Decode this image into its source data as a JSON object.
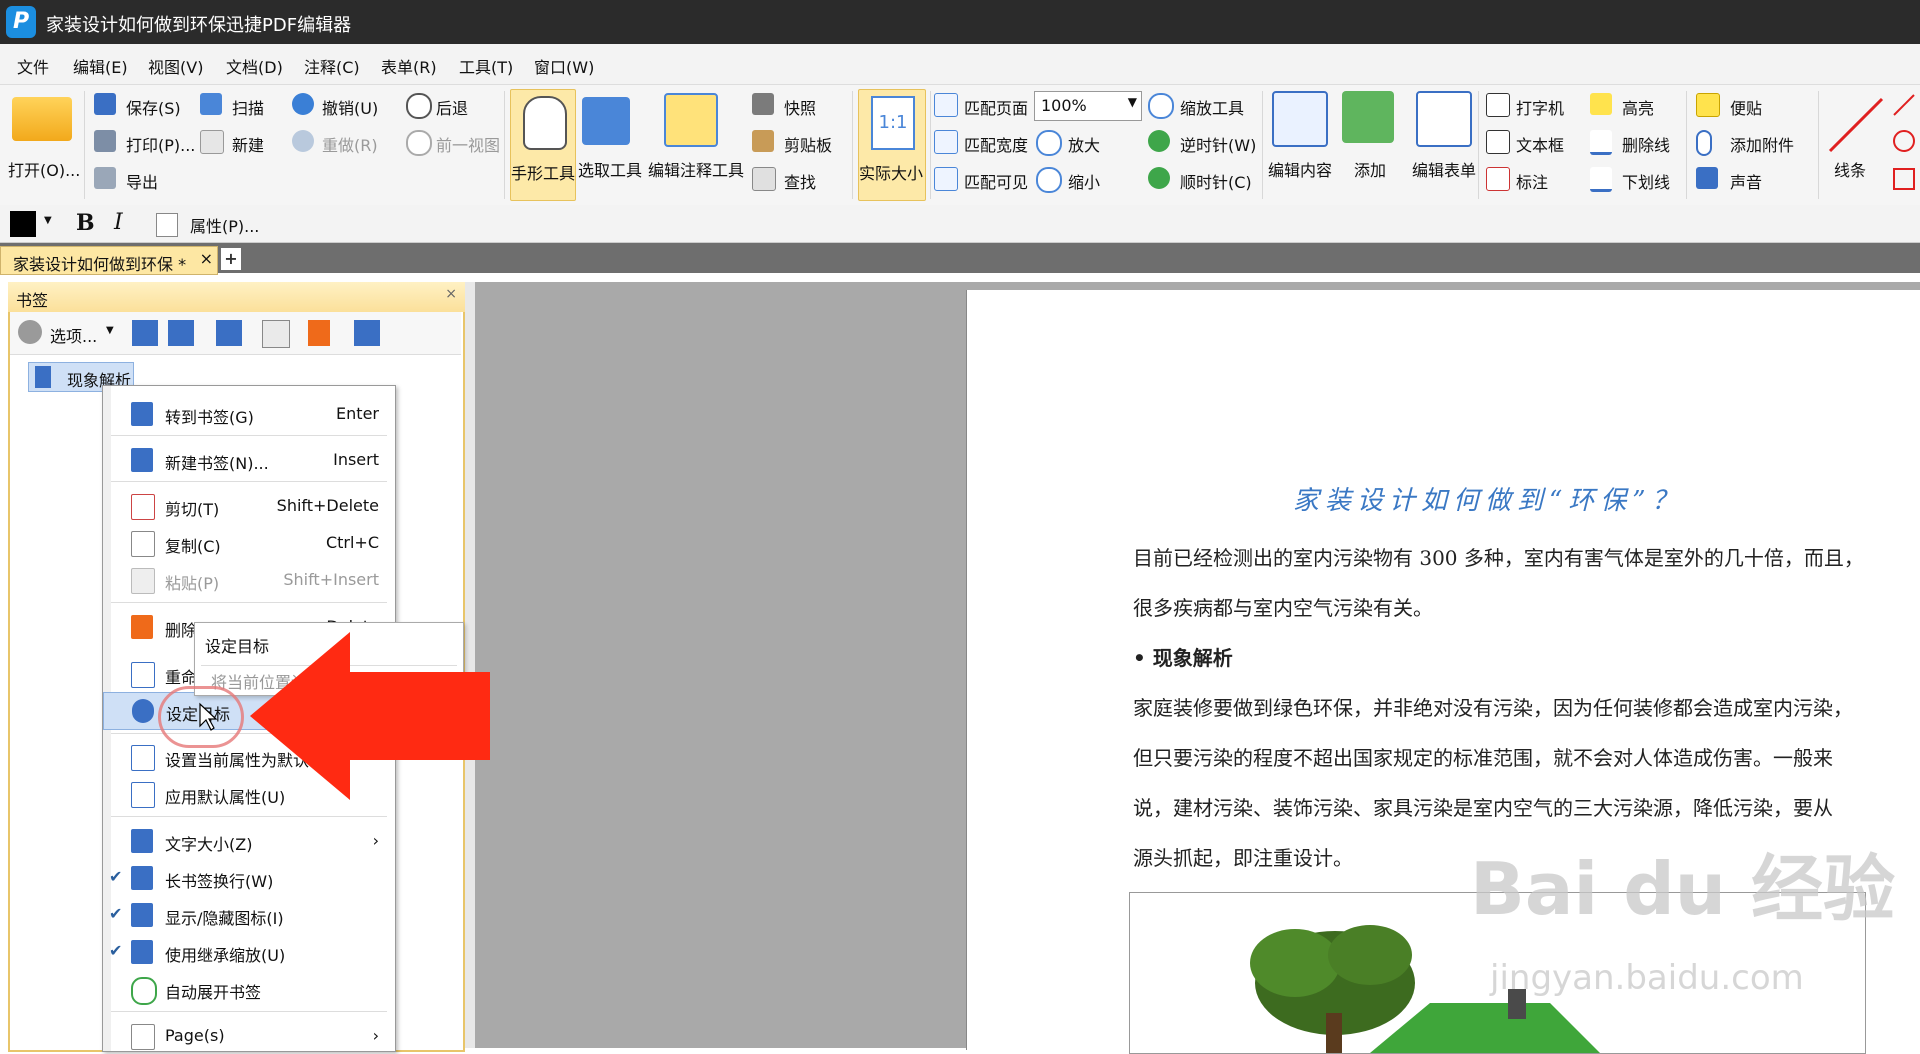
{
  "window": {
    "title": "家装设计如何做到环保迅捷PDF编辑器",
    "logo": "P"
  },
  "menubar": [
    "文件",
    "编辑(E)",
    "视图(V)",
    "文档(D)",
    "注释(C)",
    "表单(R)",
    "工具(T)",
    "窗口(W)"
  ],
  "ribbon": {
    "open": "打开(O)...",
    "save": "保存(S)",
    "print": "打印(P)...",
    "export": "导出",
    "scan": "扫描",
    "new": "新建",
    "undo": "撤销(U)",
    "redo": "重做(R)",
    "back": "后退",
    "prev_view": "前一视图",
    "hand_tool": "手形工具",
    "select_tool": "选取工具",
    "edit_annot_tool": "编辑注释工具",
    "snapshot": "快照",
    "clipboard": "剪贴板",
    "find": "查找",
    "actual_size": "实际大小",
    "actual_size_icon": "1:1",
    "fit_page": "匹配页面",
    "fit_width": "匹配宽度",
    "fit_visible": "匹配可见",
    "zoom_value": "100%",
    "zoom_in": "放大",
    "zoom_out": "缩小",
    "zoom_tool": "缩放工具",
    "rotate_ccw": "逆时针(W)",
    "rotate_cw": "顺时针(C)",
    "edit_content": "编辑内容",
    "add": "添加",
    "edit_form": "编辑表单",
    "typewriter": "打字机",
    "textbox": "文本框",
    "callout": "标注",
    "highlight": "高亮",
    "strikeout": "删除线",
    "underline": "下划线",
    "sticky": "便贴",
    "attach": "添加附件",
    "sound": "声音",
    "line": "线条"
  },
  "formatbar": {
    "bold": "B",
    "italic": "I",
    "properties": "属性(P)..."
  },
  "tab": {
    "label": "家装设计如何做到环保 *",
    "close": "×",
    "add": "+"
  },
  "panel": {
    "title": "书签",
    "close": "×",
    "options": "选项...",
    "bookmark_item": "现象解析"
  },
  "context_menu": {
    "items": [
      {
        "label": "转到书签(G)",
        "shortcut": "Enter"
      },
      {
        "label": "新建书签(N)...",
        "shortcut": "Insert"
      },
      {
        "label": "剪切(T)",
        "shortcut": "Shift+Delete"
      },
      {
        "label": "复制(C)",
        "shortcut": "Ctrl+C"
      },
      {
        "label": "粘贴(P)",
        "shortcut": "Shift+Insert"
      },
      {
        "label": "删除(D)",
        "shortcut": "Delete"
      },
      {
        "label": "重命名(R)",
        "shortcut": ""
      },
      {
        "label": "设定目标",
        "shortcut": ""
      },
      {
        "label": "设置当前属性为默认",
        "shortcut": ""
      },
      {
        "label": "应用默认属性(U)",
        "shortcut": ""
      },
      {
        "label": "文字大小(Z)",
        "shortcut": "›"
      },
      {
        "label": "长书签换行(W)",
        "shortcut": ""
      },
      {
        "label": "显示/隐藏图标(I)",
        "shortcut": ""
      },
      {
        "label": "使用继承缩放(U)",
        "shortcut": ""
      },
      {
        "label": "自动展开书签",
        "shortcut": ""
      },
      {
        "label": "Page(s)",
        "shortcut": "›"
      }
    ],
    "submenu": {
      "item1": "设定目标",
      "item2": "将当前位置设为目标"
    }
  },
  "document": {
    "heading": "家装设计如何做到“环保”？",
    "para1_line1": "目前已经检测出的室内污染物有 300 多种，室内有害气体是室外的几十倍，而且，",
    "para1_line2": "很多疾病都与室内空气污染有关。",
    "section": "• 现象解析",
    "para2_line1": "家庭装修要做到绿色环保，并非绝对没有污染，因为任何装修都会造成室内污染，",
    "para2_line2": "但只要污染的程度不超出国家规定的标准范围，就不会对人体造成伤害。一般来",
    "para2_line3": "说，建材污染、装饰污染、家具污染是室内空气的三大污染源，降低污染，要从",
    "para2_line4": "源头抓起，即注重设计。"
  },
  "watermark": {
    "brand": "Bai du 经验",
    "url": "jingyan.baidu.com"
  },
  "colors": {
    "accent_orange": "#f5a623",
    "highlight": "#fde9a8",
    "arrow": "#ff2a12"
  }
}
